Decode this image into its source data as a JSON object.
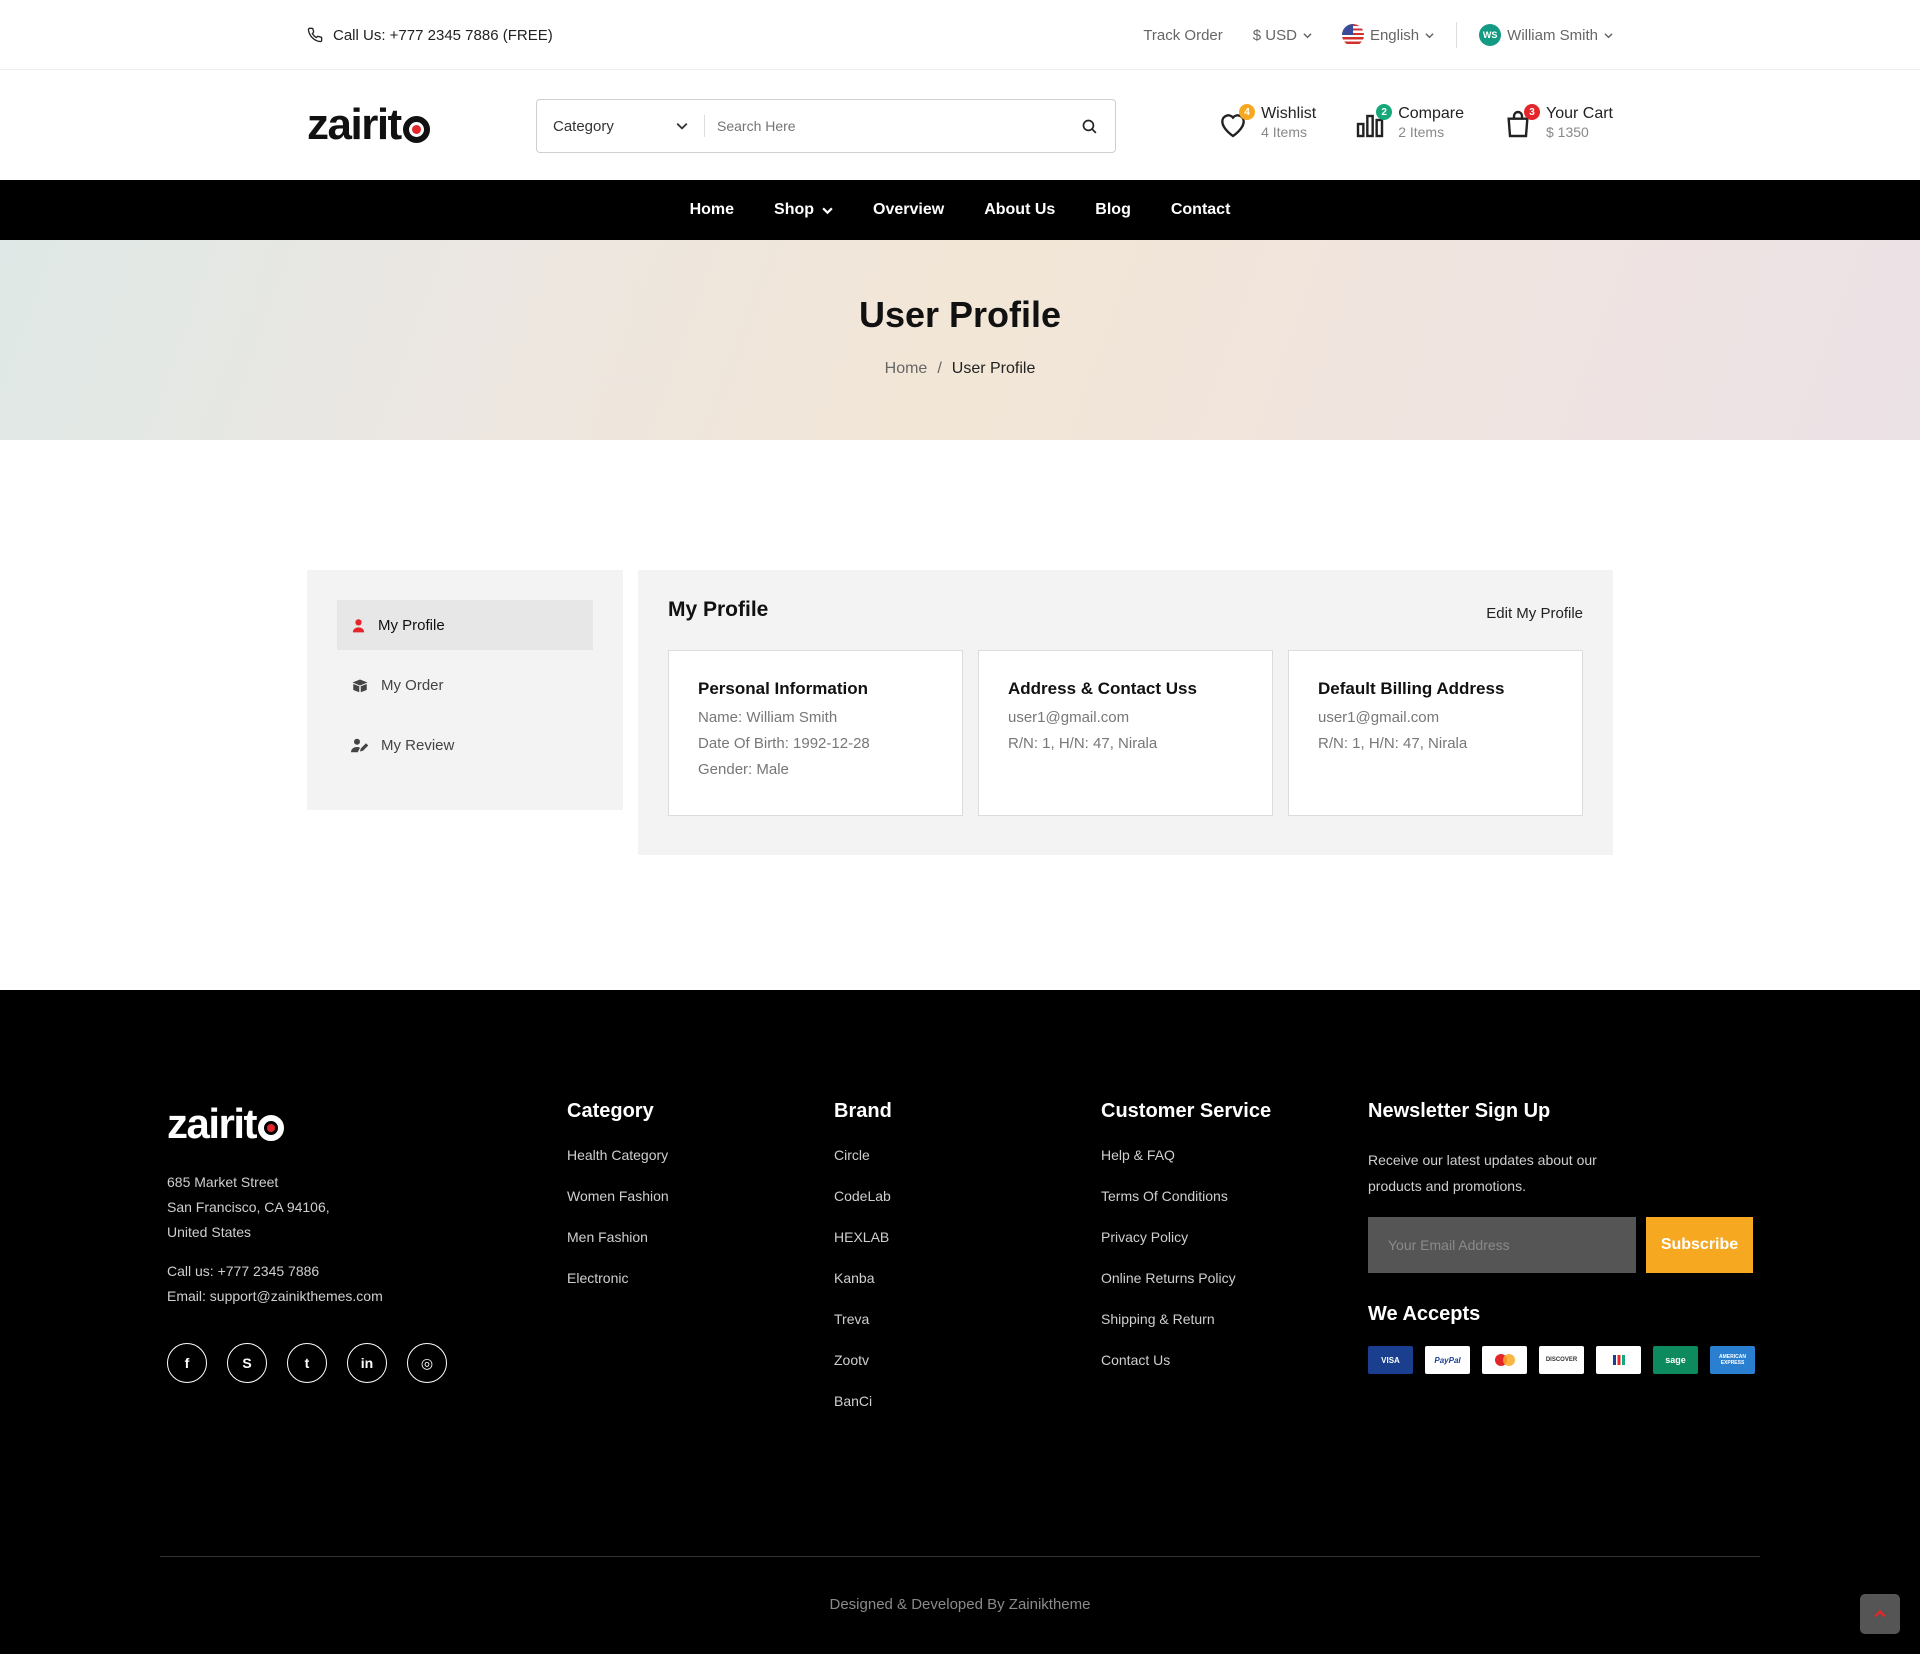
{
  "topbar": {
    "call": "Call Us: +777 2345 7886 (FREE)",
    "track_order": "Track Order",
    "currency": "$ USD",
    "language": "English",
    "user_initials": "WS",
    "user_name": "William Smith"
  },
  "header": {
    "logo": "zairit",
    "search": {
      "category": "Category",
      "placeholder": "Search Here"
    },
    "wishlist": {
      "label": "Wishlist",
      "sub": "4 Items",
      "badge": "4",
      "badge_color": "#f7a821"
    },
    "compare": {
      "label": "Compare",
      "sub": "2 Items",
      "badge": "2",
      "badge_color": "#16a87a"
    },
    "cart": {
      "label": "Your Cart",
      "sub": "$ 1350",
      "badge": "3",
      "badge_color": "#e4262b"
    }
  },
  "nav": [
    "Home",
    "Shop",
    "Overview",
    "About Us",
    "Blog",
    "Contact"
  ],
  "banner": {
    "title": "User Profile",
    "crumb_home": "Home",
    "crumb_sep": "/",
    "crumb_current": "User Profile"
  },
  "sidebar": [
    {
      "label": "My Profile",
      "icon": "user-icon"
    },
    {
      "label": "My Order",
      "icon": "box-icon"
    },
    {
      "label": "My Review",
      "icon": "user-edit-icon"
    }
  ],
  "profile": {
    "title": "My Profile",
    "edit": "Edit My Profile",
    "cards": [
      {
        "title": "Personal Information",
        "lines": [
          "Name: William Smith",
          "Date Of Birth: 1992-12-28",
          "Gender: Male"
        ]
      },
      {
        "title": "Address & Contact Uss",
        "lines": [
          "user1@gmail.com",
          "R/N: 1, H/N: 47, Nirala"
        ]
      },
      {
        "title": "Default Billing Address",
        "lines": [
          "user1@gmail.com",
          "R/N: 1, H/N: 47, Nirala"
        ]
      }
    ]
  },
  "footer": {
    "logo": "zairit",
    "address": [
      "685 Market Street",
      "San Francisco, CA 94106,",
      "United States"
    ],
    "call": "Call us: +777 2345 7886",
    "email": "Email: support@zainikthemes.com",
    "social": [
      {
        "icon": "facebook-icon",
        "glyph": "f"
      },
      {
        "icon": "skype-icon",
        "glyph": "S"
      },
      {
        "icon": "twitter-icon",
        "glyph": "t"
      },
      {
        "icon": "linkedin-icon",
        "glyph": "in"
      },
      {
        "icon": "instagram-icon",
        "glyph": "◎"
      }
    ],
    "category": {
      "title": "Category",
      "links": [
        "Health Category",
        "Women Fashion",
        "Men Fashion",
        "Electronic"
      ]
    },
    "brand": {
      "title": "Brand",
      "links": [
        "Circle",
        "CodeLab",
        "HEXLAB",
        "Kanba",
        "Treva",
        "Zootv",
        "BanCi"
      ]
    },
    "service": {
      "title": "Customer Service",
      "links": [
        "Help & FAQ",
        "Terms Of Conditions",
        "Privacy Policy",
        "Online Returns Policy",
        "Shipping & Return",
        "Contact Us"
      ]
    },
    "newsletter": {
      "title": "Newsletter Sign Up",
      "text": "Receive our latest updates about our products and promotions.",
      "placeholder": "Your Email Address",
      "button": "Subscribe"
    },
    "accepts": "We Accepts",
    "payments": [
      {
        "name": "VISA",
        "bg": "#1a3f8f",
        "fg": "#ffffff"
      },
      {
        "name": "PayPal",
        "bg": "#ffffff",
        "fg": "#1a3f8f"
      },
      {
        "name": "mastercard-icon",
        "bg": "#ffffff",
        "fg": "#e4262b"
      },
      {
        "name": "DISCOVER",
        "bg": "#ffffff",
        "fg": "#333333"
      },
      {
        "name": "jcb-icon",
        "bg": "#ffffff",
        "fg": "#16a87a"
      },
      {
        "name": "sage",
        "bg": "#0d8a5e",
        "fg": "#ffffff"
      },
      {
        "name": "AMERICAN EXPRESS",
        "bg": "#2a7fd1",
        "fg": "#ffffff"
      }
    ],
    "copyright": "Designed & Developed By Zainiktheme"
  }
}
